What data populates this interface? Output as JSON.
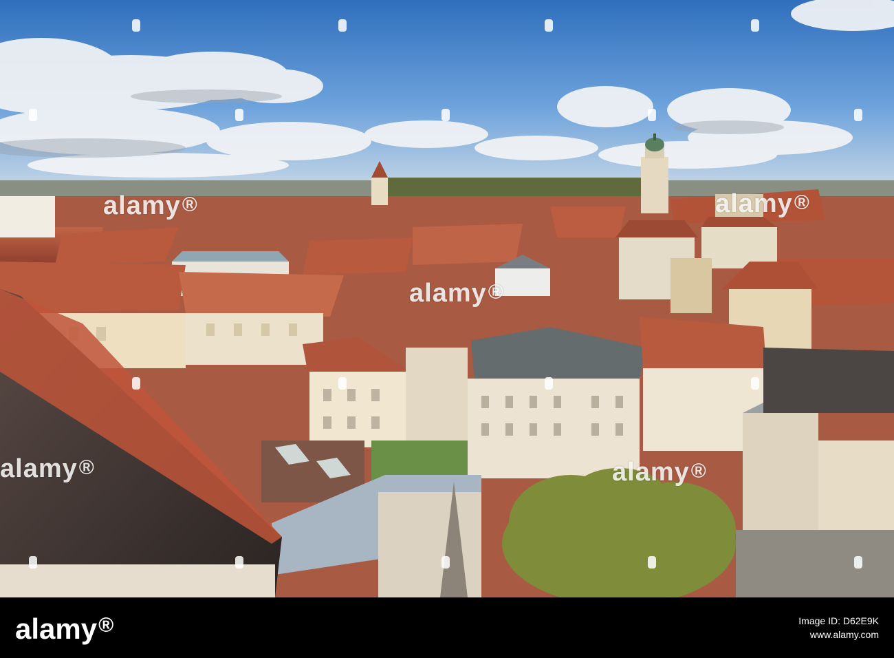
{
  "photo": {
    "subject": "aerial-view-old-town-rooftops",
    "watermark_text": "alamy",
    "watermark_symbol": "®"
  },
  "footer": {
    "logo_text": "alamy",
    "logo_symbol": "®",
    "image_id_label": "Image ID: D62E9K",
    "site_url": "www.alamy.com"
  },
  "colors": {
    "sky_top": "#3f7fc9",
    "roof": "#b4553a",
    "facade": "#ece1c8",
    "footer_bg": "#000000"
  }
}
